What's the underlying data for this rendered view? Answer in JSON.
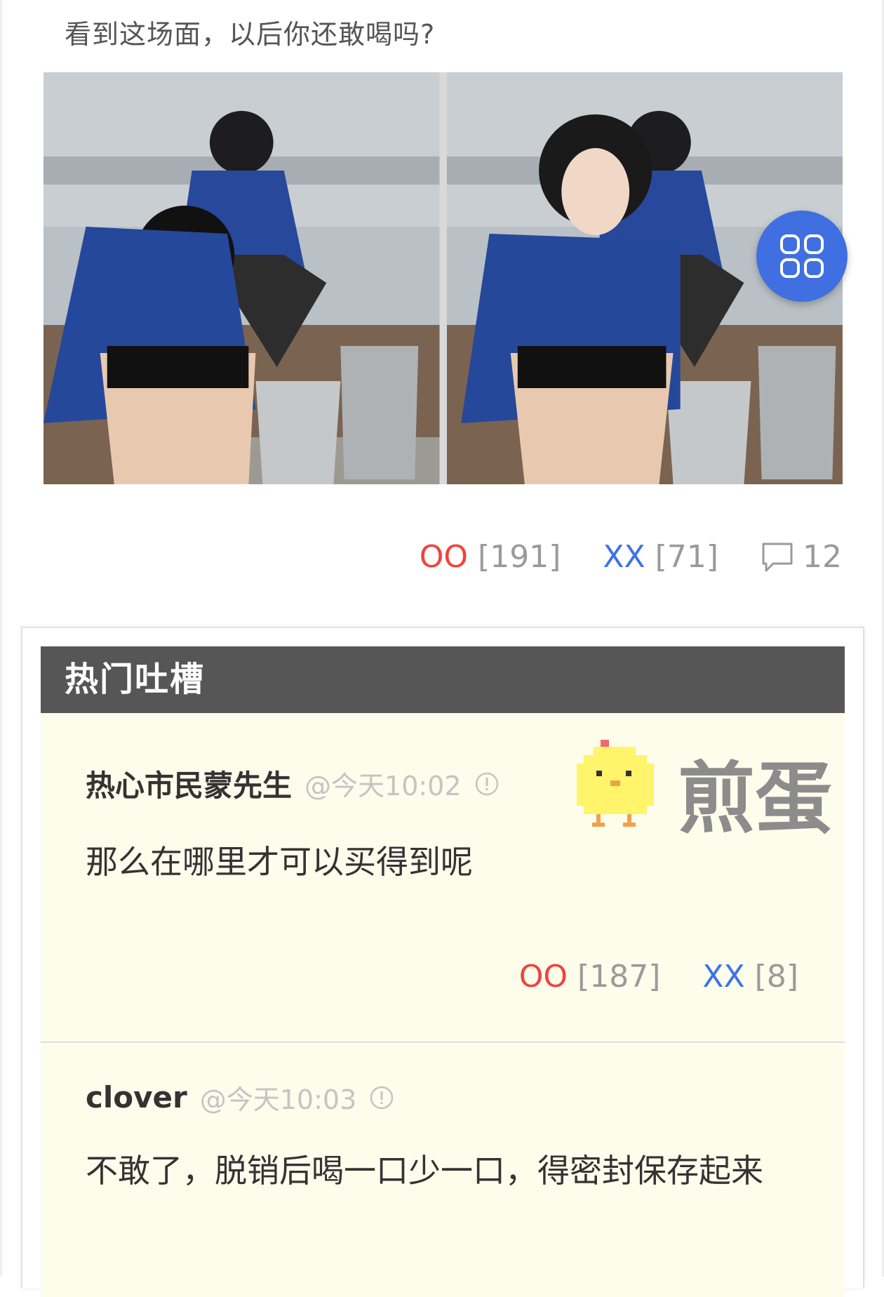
{
  "post": {
    "caption": "看到这场面，以后你还敢喝吗?",
    "oo_label": "OO",
    "oo_count": "[191]",
    "xx_label": "XX",
    "xx_count": "[71]",
    "comment_count": "12"
  },
  "hot": {
    "title": "热门吐槽",
    "logo_text": "煎蛋",
    "comments": [
      {
        "author": "热心市民蒙先生",
        "time": "@今天10:02",
        "text": "那么在哪里才可以买得到呢",
        "oo_label": "OO",
        "oo_count": "[187]",
        "xx_label": "XX",
        "xx_count": "[8]"
      },
      {
        "author": "clover",
        "time": "@今天10:03",
        "text": "不敢了，脱销后喝一口少一口，得密封保存起来"
      }
    ]
  },
  "icons": {
    "fab": "grid-apps-icon",
    "comment": "speech-bubble-icon",
    "info": "info-circle-icon"
  },
  "colors": {
    "oo": "#f2423c",
    "xx": "#3c73e6",
    "fab": "#3f6fe0",
    "header_bg": "#565656",
    "comment_bg": "#fdfdec"
  }
}
